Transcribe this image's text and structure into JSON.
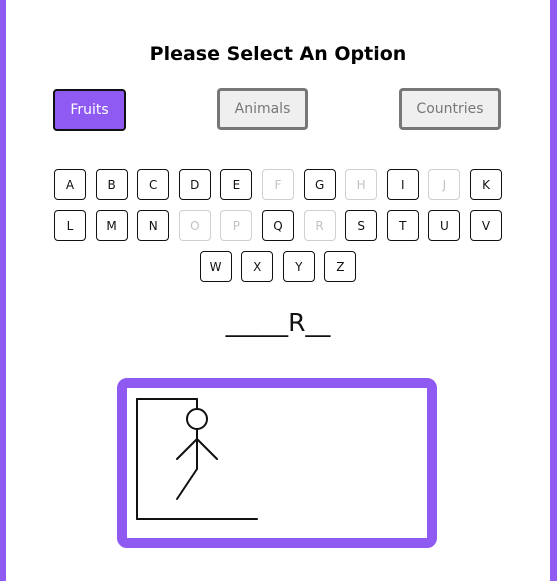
{
  "title": "Please Select An Option",
  "categories": [
    {
      "label": "Fruits",
      "state": "active"
    },
    {
      "label": "Animals",
      "state": "inactive"
    },
    {
      "label": "Countries",
      "state": "inactive"
    }
  ],
  "keyboard": {
    "row1": [
      "A",
      "B",
      "C",
      "D",
      "E",
      "F",
      "G",
      "H",
      "I",
      "J",
      "K"
    ],
    "row2": [
      "L",
      "M",
      "N",
      "O",
      "P",
      "Q",
      "R",
      "S",
      "T",
      "U",
      "V"
    ],
    "row3": [
      "W",
      "X",
      "Y",
      "Z"
    ],
    "used_letters": [
      "F",
      "H",
      "J",
      "O",
      "P",
      "R"
    ]
  },
  "word_display": "_____R__",
  "hangman": {
    "parts_shown": [
      "head",
      "body",
      "left-arm",
      "right-arm",
      "left-leg"
    ]
  },
  "colors": {
    "accent": "#8e5af2",
    "inactive_border": "#777777",
    "used_key": "#c2c2c2"
  }
}
